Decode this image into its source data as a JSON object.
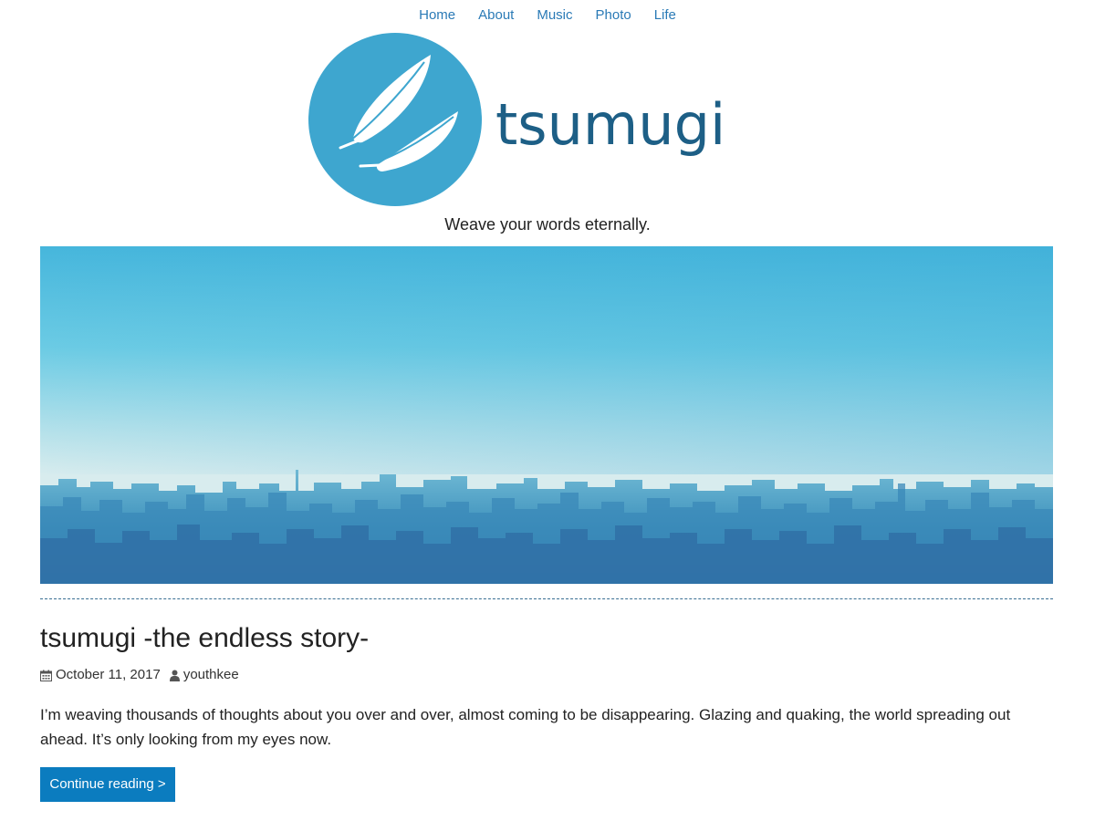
{
  "nav": {
    "items": [
      {
        "label": "Home"
      },
      {
        "label": "About"
      },
      {
        "label": "Music"
      },
      {
        "label": "Photo"
      },
      {
        "label": "Life"
      }
    ]
  },
  "site": {
    "logo_text": "tsumugi",
    "tagline": "Weave your words eternally."
  },
  "post": {
    "title": "tsumugi -the endless story-",
    "date": "October 11, 2017",
    "author": "youthkee",
    "excerpt": "I’m weaving thousands of thoughts about you over and over, almost coming to be disappearing. Glazing and quaking, the world spreading out ahead. It’s only looking from my eyes now.",
    "continue_label": "Continue reading >"
  },
  "icons": {
    "date": "calendar-icon",
    "author": "user-icon",
    "logo": "feather-icon"
  },
  "colors": {
    "accent": "#0b7cbf",
    "link": "#2a7ab6",
    "logo_circle": "#3ea6cf",
    "logo_text": "#1d5f86"
  }
}
